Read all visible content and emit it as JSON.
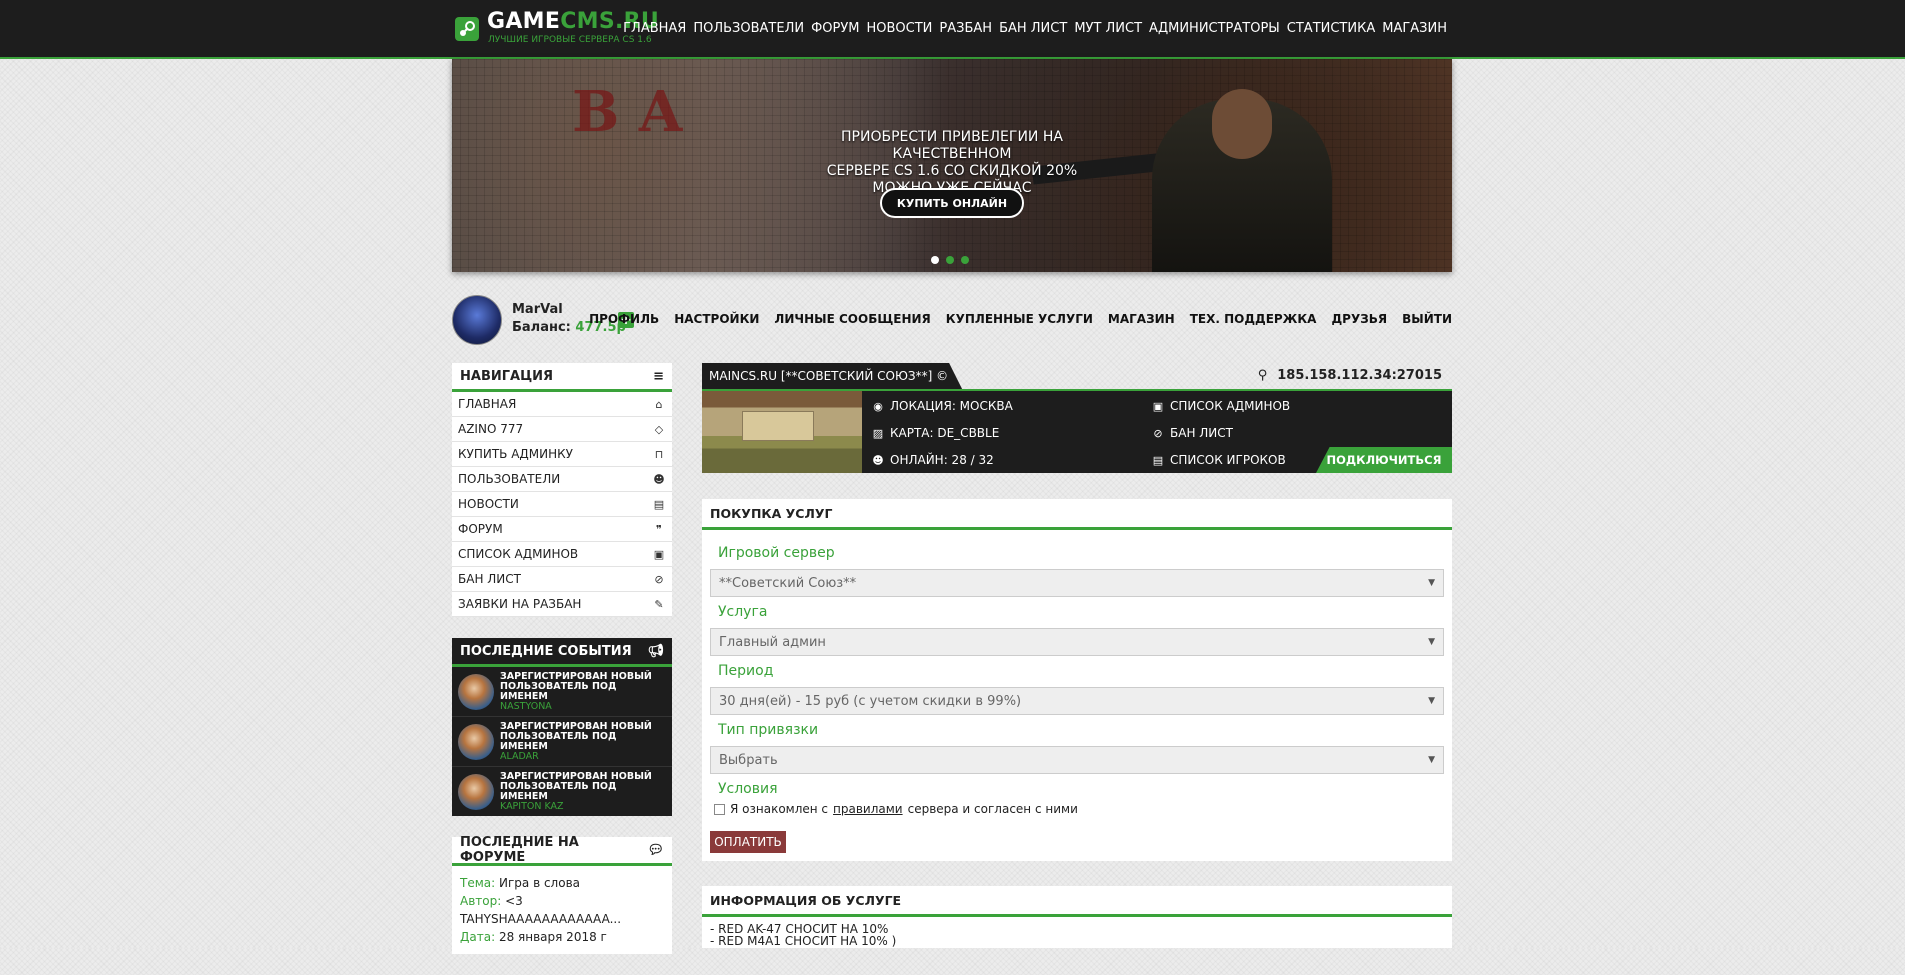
{
  "header": {
    "logo_main": "GAME",
    "logo_accent": "CMS.RU",
    "logo_sub": "ЛУЧШИЕ ИГРОВЫЕ СЕРВЕРА CS 1.6",
    "nav": [
      "ГЛАВНАЯ",
      "ПОЛЬЗОВАТЕЛИ",
      "ФОРУМ",
      "НОВОСТИ",
      "РАЗБАН",
      "БАН ЛИСТ",
      "МУТ ЛИСТ",
      "АДМИНИСТРАТОРЫ",
      "СТАТИСТИКА",
      "МАГАЗИН"
    ]
  },
  "banner": {
    "text_line1": "ПРИОБРЕСТИ ПРИВЕЛЕГИИ НА КАЧЕСТВЕННОМ",
    "text_line2": "СЕРВЕРЕ CS 1.6 СО СКИДКОЙ 20%",
    "text_line3": "МОЖНО УЖЕ СЕЙЧАС",
    "button": "КУПИТЬ ОНЛАЙН",
    "slides_count": 3,
    "active_slide": 1
  },
  "user": {
    "name": "MarVal",
    "balance_label": "Баланс:",
    "balance_value": "477.5р",
    "add_label": "+",
    "menu": [
      "ПРОФИЛЬ",
      "НАСТРОЙКИ",
      "ЛИЧНЫЕ СООБЩЕНИЯ",
      "КУПЛЕННЫЕ УСЛУГИ",
      "МАГАЗИН",
      "ТЕХ. ПОДДЕРЖКА",
      "ДРУЗЬЯ",
      "ВЫЙТИ"
    ]
  },
  "sidebar": {
    "nav_title": "НАВИГАЦИЯ",
    "nav_items": [
      {
        "label": "ГЛАВНАЯ",
        "icon": "home-icon",
        "glyph": "⌂"
      },
      {
        "label": "AZINO 777",
        "icon": "diamond-icon",
        "glyph": "◇"
      },
      {
        "label": "КУПИТЬ АДМИНКУ",
        "icon": "cart-icon",
        "glyph": "⊓"
      },
      {
        "label": "ПОЛЬЗОВАТЕЛИ",
        "icon": "users-icon",
        "glyph": "☻"
      },
      {
        "label": "НОВОСТИ",
        "icon": "newspaper-icon",
        "glyph": "▤"
      },
      {
        "label": "ФОРУМ",
        "icon": "chat-icon",
        "glyph": "❞"
      },
      {
        "label": "СПИСОК АДМИНОВ",
        "icon": "id-card-icon",
        "glyph": "▣"
      },
      {
        "label": "БАН ЛИСТ",
        "icon": "ban-icon",
        "glyph": "⊘"
      },
      {
        "label": "ЗАЯВКИ НА РАЗБАН",
        "icon": "edit-icon",
        "glyph": "✎"
      }
    ],
    "events_title": "ПОСЛЕДНИЕ СОБЫТИЯ",
    "events": [
      {
        "text": "ЗАРЕГИСТРИРОВАН НОВЫЙ ПОЛЬЗОВАТЕЛЬ ПОД ИМЕНЕМ",
        "name": "NASTYONA"
      },
      {
        "text": "ЗАРЕГИСТРИРОВАН НОВЫЙ ПОЛЬЗОВАТЕЛЬ ПОД ИМЕНЕМ",
        "name": "ALADAR"
      },
      {
        "text": "ЗАРЕГИСТРИРОВАН НОВЫЙ ПОЛЬЗОВАТЕЛЬ ПОД ИМЕНЕМ",
        "name": "KAPITON KAZ"
      }
    ],
    "forum_title": "ПОСЛЕДНИЕ НА ФОРУМЕ",
    "forum": {
      "topic_label": "Тема:",
      "topic": "Игра в слова",
      "author_label": "Автор:",
      "author": "<3 TAHYSHAAAAAAAAAAAA...",
      "date_label": "Дата:",
      "date": "28 января 2018 г"
    }
  },
  "server": {
    "name": "MAINCS.RU [**СОВЕТСКИЙ СОЮЗ**] ©",
    "ip": "185.158.112.34:27015",
    "location": "ЛОКАЦИЯ: МОСКВА",
    "map": "КАРТА: DE_CBBLE",
    "online": "ОНЛАЙН: 28 / 32",
    "admins": "СПИСОК АДМИНОВ",
    "banlist": "БАН ЛИСТ",
    "players": "СПИСОК ИГРОКОВ",
    "connect": "ПОДКЛЮЧИТЬСЯ"
  },
  "purchase": {
    "title": "ПОКУПКА УСЛУГ",
    "server_label": "Игровой сервер",
    "server_value": "**Советский Союз**",
    "service_label": "Услуга",
    "service_value": "Главный админ",
    "period_label": "Период",
    "period_value": "30 дня(ей) - 15 руб (с учетом скидки в 99%)",
    "binding_label": "Тип привязки",
    "binding_value": "Выбрать",
    "terms_label": "Условия",
    "terms_before": "Я ознакомлен с",
    "terms_link": "правилами",
    "terms_after": "сервера и согласен с ними",
    "pay_button": "ОПЛАТИТЬ"
  },
  "service_info": {
    "title": "ИНФОРМАЦИЯ ОБ УСЛУГЕ",
    "lines": [
      "- RED AK-47 СНОСИТ НА 10%",
      "- RED M4A1 СНОСИТ НА 10% )"
    ]
  },
  "colors": {
    "accent": "#3aa23a",
    "dark": "#1d1d1d",
    "pay": "#8a3a3a"
  }
}
